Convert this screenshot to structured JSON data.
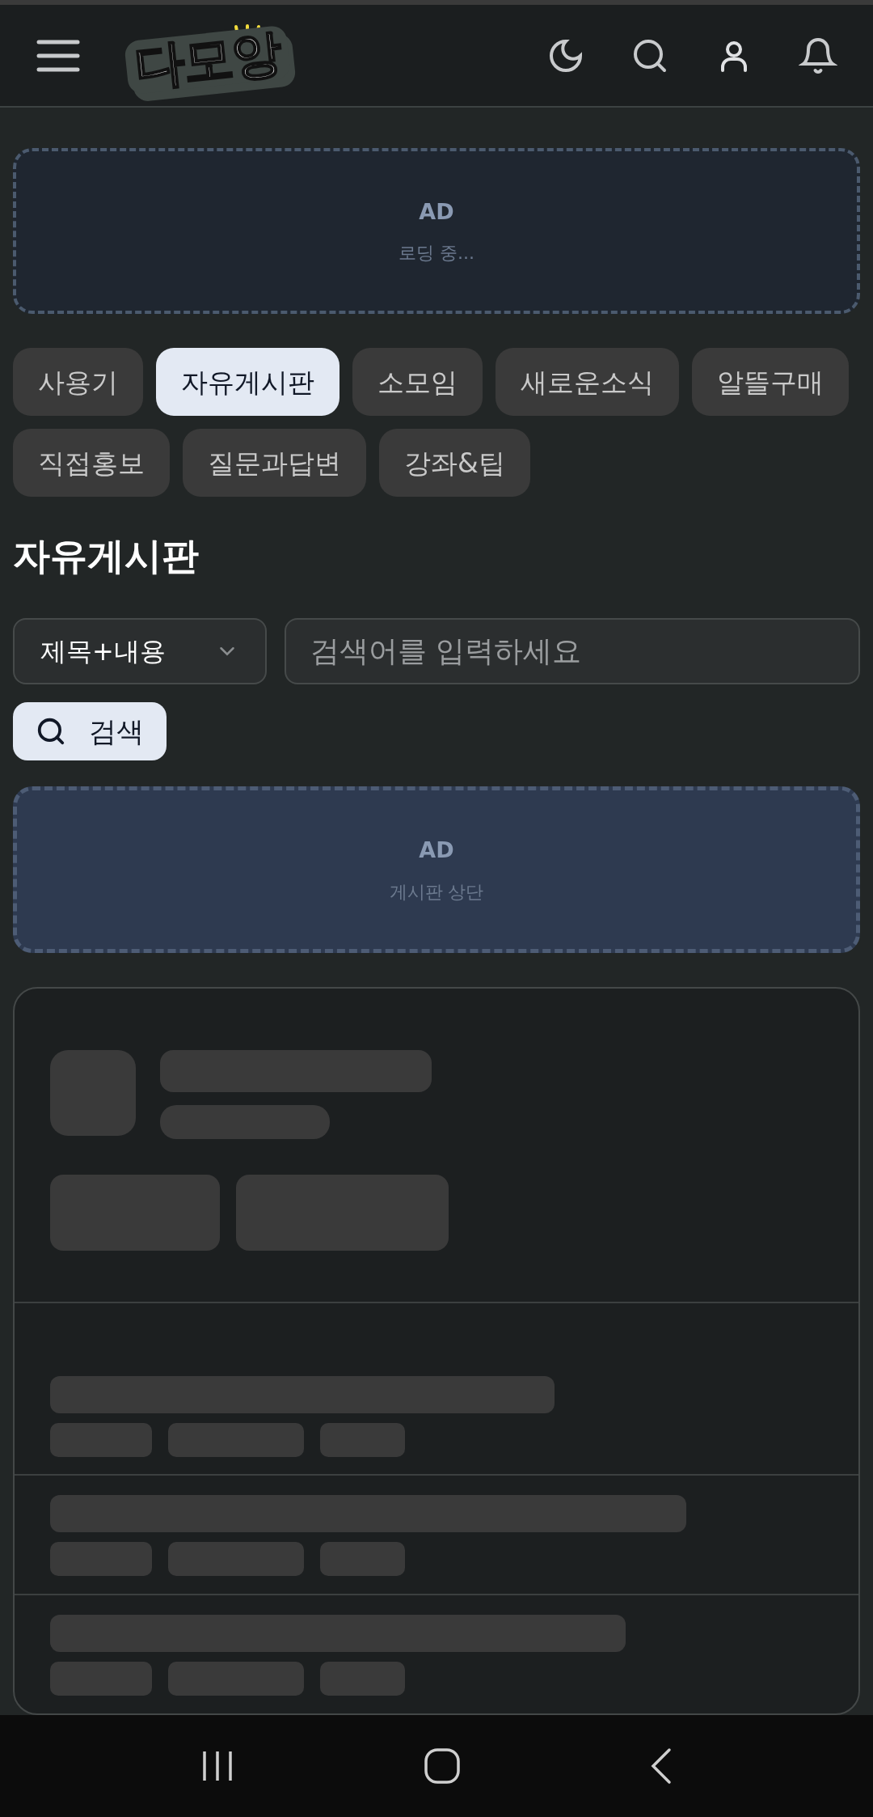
{
  "header": {
    "logo": "다모앙"
  },
  "top_ad": {
    "label": "AD",
    "status": "로딩 중..."
  },
  "categories": [
    {
      "label": "사용기",
      "selected": false
    },
    {
      "label": "자유게시판",
      "selected": true
    },
    {
      "label": "소모임",
      "selected": false
    },
    {
      "label": "새로운소식",
      "selected": false
    },
    {
      "label": "알뜰구매",
      "selected": false
    },
    {
      "label": "직접홍보",
      "selected": false
    },
    {
      "label": "질문과답변",
      "selected": false
    },
    {
      "label": "강좌&팁",
      "selected": false
    }
  ],
  "board_title": "자유게시판",
  "search": {
    "scope": "제목+내용",
    "placeholder": "검색어를 입력하세요",
    "button": "검색"
  },
  "board_ad": {
    "label": "AD",
    "caption": "게시판 상단"
  }
}
